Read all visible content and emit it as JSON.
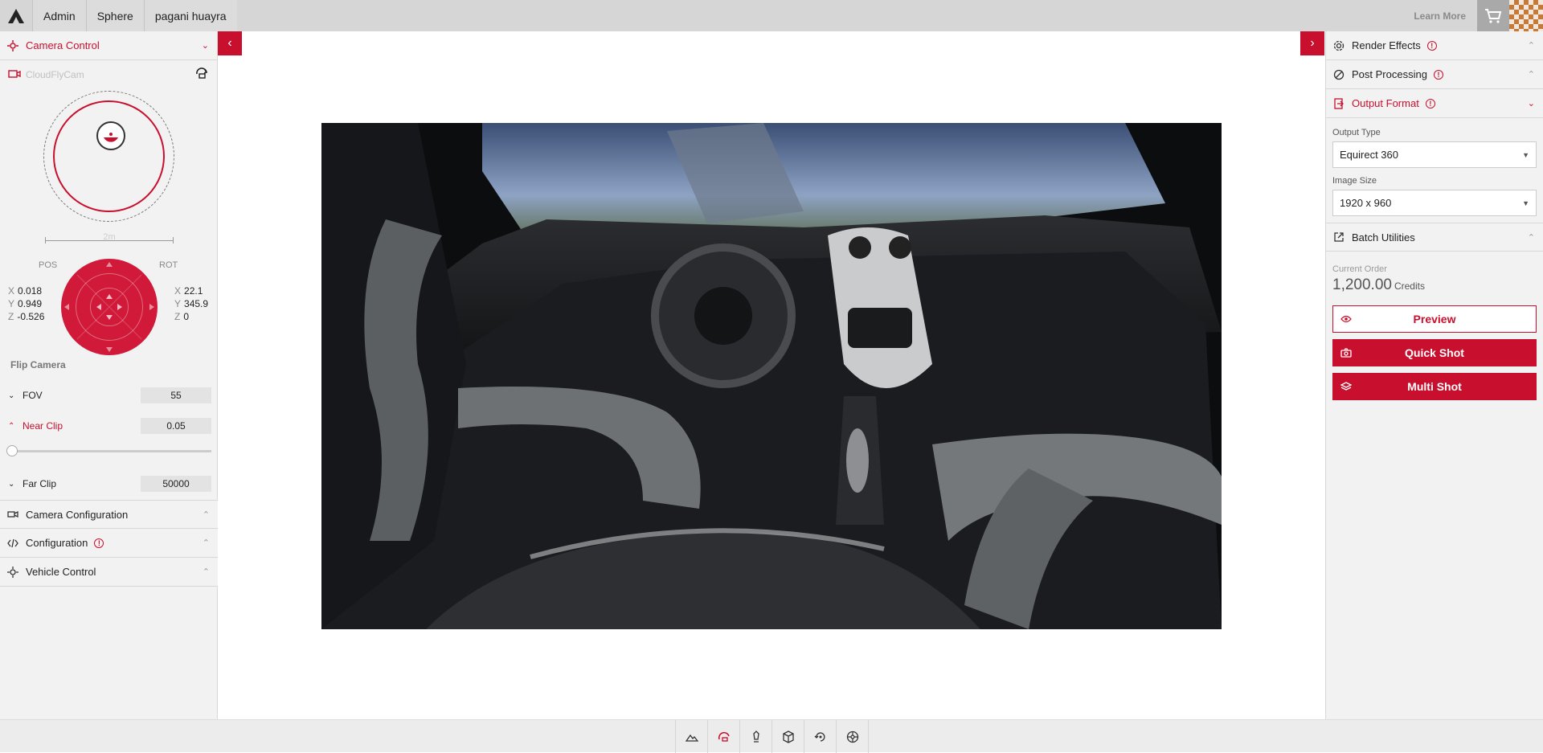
{
  "nav": {
    "breadcrumbs": [
      "Admin",
      "Sphere",
      "pagani huayra"
    ],
    "learn_more": "Learn More"
  },
  "left": {
    "camera_control": "Camera Control",
    "camera_name": "CloudFlyCam",
    "distance": "2m",
    "pos_label": "POS",
    "rot_label": "ROT",
    "pos": {
      "x": "0.018",
      "y": "0.949",
      "z": "-0.526"
    },
    "rot": {
      "x": "22.1",
      "y": "345.9",
      "z": "0"
    },
    "axis": {
      "x": "X",
      "y": "Y",
      "z": "Z"
    },
    "flip_camera": "Flip Camera",
    "fov_label": "FOV",
    "fov_value": "55",
    "near_clip_label": "Near Clip",
    "near_clip_value": "0.05",
    "far_clip_label": "Far Clip",
    "far_clip_value": "50000",
    "camera_configuration": "Camera Configuration",
    "configuration": "Configuration",
    "vehicle_control": "Vehicle Control"
  },
  "right": {
    "render_effects": "Render Effects",
    "post_processing": "Post Processing",
    "output_format": "Output Format",
    "output_type_label": "Output Type",
    "output_type_value": "Equirect 360",
    "image_size_label": "Image Size",
    "image_size_value": "1920 x 960",
    "batch_utilities": "Batch Utilities",
    "current_order_label": "Current Order",
    "current_order_value": "1,200.00",
    "credits": "Credits",
    "preview": "Preview",
    "quick_shot": "Quick Shot",
    "multi_shot": "Multi Shot"
  },
  "colors": {
    "accent": "#c8102e",
    "panel": "#f2f2f2"
  },
  "icons": {
    "bottom_tools": [
      "environment-icon",
      "camera-path-icon",
      "light-icon",
      "cube-icon",
      "rotate-icon",
      "wheel-icon"
    ]
  }
}
